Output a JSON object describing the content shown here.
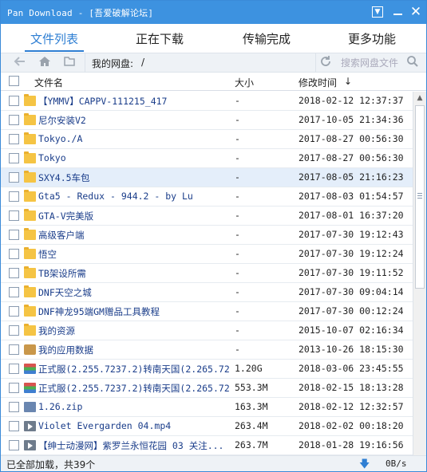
{
  "window": {
    "title": "Pan Download - [吾爱破解论坛]",
    "accent_color": "#3d92e0"
  },
  "tabs": [
    {
      "label": "文件列表",
      "active": true
    },
    {
      "label": "正在下载",
      "active": false
    },
    {
      "label": "传输完成",
      "active": false
    },
    {
      "label": "更多功能",
      "active": false
    }
  ],
  "toolbar": {
    "back_icon": "arrow-left-icon",
    "home_icon": "home-icon",
    "folder_icon": "folder-icon",
    "path_label": "我的网盘:",
    "path_value": "/",
    "refresh_icon": "refresh-icon",
    "search_placeholder": "搜索网盘文件",
    "search_icon": "search-icon"
  },
  "header": {
    "name": "文件名",
    "size": "大小",
    "modified": "修改时间",
    "sort_icon": "↓"
  },
  "files": [
    {
      "type": "folder",
      "name": "【YMMV】CAPPV-111215_417",
      "size": "-",
      "modified": "2018-02-12 12:37:37"
    },
    {
      "type": "folder",
      "name": "尼尔安装V2",
      "size": "-",
      "modified": "2017-10-05 21:34:36"
    },
    {
      "type": "folder",
      "name": "Tokyo./A",
      "size": "-",
      "modified": "2017-08-27 00:56:30"
    },
    {
      "type": "folder",
      "name": "Tokyo",
      "size": "-",
      "modified": "2017-08-27 00:56:30"
    },
    {
      "type": "folder",
      "name": "SXY4.5车包",
      "size": "-",
      "modified": "2017-08-05 21:16:23",
      "selected": true
    },
    {
      "type": "folder",
      "name": "Gta5 - Redux - 944.2 - by Lu",
      "size": "-",
      "modified": "2017-08-03 01:54:57"
    },
    {
      "type": "folder",
      "name": "GTA-V完美版",
      "size": "-",
      "modified": "2017-08-01 16:37:20"
    },
    {
      "type": "folder",
      "name": "高级客户端",
      "size": "-",
      "modified": "2017-07-30 19:12:43"
    },
    {
      "type": "folder",
      "name": "悟空",
      "size": "-",
      "modified": "2017-07-30 19:12:24"
    },
    {
      "type": "folder",
      "name": "TB架设所需",
      "size": "-",
      "modified": "2017-07-30 19:11:52"
    },
    {
      "type": "folder",
      "name": "DNF天空之城",
      "size": "-",
      "modified": "2017-07-30 09:04:14"
    },
    {
      "type": "folder",
      "name": "DNF神龙95端GM赠品工具教程",
      "size": "-",
      "modified": "2017-07-30 00:12:24"
    },
    {
      "type": "folder",
      "name": "我的资源",
      "size": "-",
      "modified": "2015-10-07 02:16:34"
    },
    {
      "type": "app",
      "name": "我的应用数据",
      "size": "-",
      "modified": "2013-10-26 18:15:30"
    },
    {
      "type": "archive",
      "name": "正式服(2.255.7237.2)转南天国(2.265.72...",
      "size": "1.20G",
      "modified": "2018-03-06 23:45:55"
    },
    {
      "type": "archive",
      "name": "正式服(2.255.7237.2)转南天国(2.265.72...",
      "size": "553.3M",
      "modified": "2018-02-15 18:13:28"
    },
    {
      "type": "zip",
      "name": "1.26.zip",
      "size": "163.3M",
      "modified": "2018-02-12 12:32:57"
    },
    {
      "type": "video",
      "name": "Violet Evergarden 04.mp4",
      "size": "263.4M",
      "modified": "2018-02-02 00:18:20"
    },
    {
      "type": "video",
      "name": "【绅士动漫网】紫罗兰永恒花园 03 关注...",
      "size": "263.7M",
      "modified": "2018-01-28 19:16:56"
    }
  ],
  "status": {
    "text": "已全部加载，共39个",
    "download_icon": "download-arrow-icon",
    "speed": "0B/s"
  }
}
